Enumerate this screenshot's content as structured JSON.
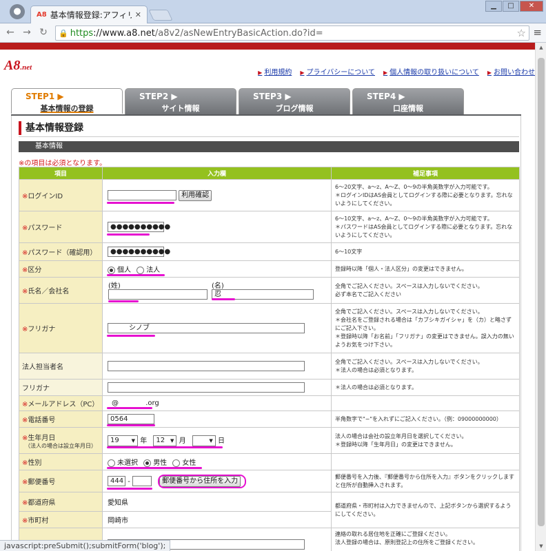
{
  "browser": {
    "tab_title": "基本情報登録:アフィリ",
    "tab_favicon": "A8",
    "url_https": "https",
    "url_host": "://www.a8.net",
    "url_path": "/a8v2/asNewEntryBasicAction.do?id=",
    "status_text": "javascript:preSubmit();submitForm('blog');"
  },
  "header": {
    "logo_main": "A8",
    "logo_sub": ".net",
    "links": [
      "利用規約",
      "プライバシーについて",
      "個人情報の取り扱いについて",
      "お問い合わせ"
    ]
  },
  "steps": [
    {
      "num": "STEP1 ▶",
      "name": "基本情報の登録"
    },
    {
      "num": "STEP2 ▶",
      "name": "サイト情報"
    },
    {
      "num": "STEP3 ▶",
      "name": "ブログ情報"
    },
    {
      "num": "STEP4 ▶",
      "name": "口座情報"
    }
  ],
  "page": {
    "title": "基本情報登録",
    "section": "基本情報",
    "required_note": "※の項目は必須となります。"
  },
  "table": {
    "headers": [
      "項目",
      "入力欄",
      "補足事項"
    ],
    "rows": {
      "login": {
        "label": "ログインID",
        "value": "",
        "button": "利用確認",
        "note": "6〜20文字、a〜z、A〜Z、0〜9の半角英数字が入力可能です。\n＊ログインIDはAS会員としてログインする際に必要となります。忘れないようにしてください。"
      },
      "password": {
        "label": "パスワード",
        "value": "●●●●●●●●●●",
        "note": "6〜10文字、a〜z、A〜Z、0〜9の半角英数字が入力可能です。\n＊パスワードはAS会員としてログインする際に必要となります。忘れないようにしてください。"
      },
      "password_confirm": {
        "label": "パスワード（確認用）",
        "value": "●●●●●●●●●●",
        "note": "6〜10文字"
      },
      "type": {
        "label": "区分",
        "opt1": "個人",
        "opt2": "法人",
        "note": "登録時以降「個人・法人区分」の変更はできません。"
      },
      "name": {
        "label": "氏名／会社名",
        "sei_label": "(姓)",
        "mei_label": "(名)",
        "sei_value": "",
        "mei_value": "忍",
        "note": "全角でご記入ください。スペースは入力しないでください。\n必ず本名でご記入ください"
      },
      "furigana": {
        "label": "フリガナ",
        "value": "シノブ",
        "note": "全角でご記入ください。スペースは入力しないでください。\n＊会社名をご登録される場合は「カブシキガイシャ」を（カ）と略さずにご記入下さい。\n＊登録時以降「お名前」「フリガナ」の変更はできません。誤入力の無いようお気をつけ下さい。"
      },
      "corp_contact": {
        "label": "法人担当者名",
        "value": "",
        "note": "全角でご記入ください。スペースは入力しないでください。\n＊法人の場合は必須となります。"
      },
      "corp_furigana": {
        "label": "フリガナ",
        "value": "",
        "note": "＊法人の場合は必須となります。"
      },
      "email": {
        "label": "メールアドレス（PC）",
        "at": "@",
        "domain": ".org"
      },
      "phone": {
        "label": "電話番号",
        "value": "0564",
        "note": "半角数字で\"−\"を入れずにご記入ください。（例：09000000000）"
      },
      "birth": {
        "label": "生年月日",
        "sublabel": "（法人の場合は設立年月日）",
        "year": "19",
        "year_unit": "年",
        "month": "12",
        "month_unit": "月",
        "day": "",
        "day_unit": "日",
        "note": "法人の場合は会社の設立年月日を選択してください。\n＊登録時以降「生年月日」の変更はできません。"
      },
      "gender": {
        "label": "性別",
        "opt1": "未選択",
        "opt2": "男性",
        "opt3": "女性"
      },
      "zip": {
        "label": "郵便番号",
        "value1": "444",
        "dash": "-",
        "value2": "",
        "button": "郵便番号から住所を入力",
        "note": "郵便番号を入力後、『郵便番号から住所を入力』ボタンをクリックしますと住所が自動挿入されます。"
      },
      "pref": {
        "label": "都道府県",
        "value": "愛知県",
        "note": "都道府県・市町村は入力できませんので、上記ボタンから選択するようにしてください。"
      },
      "city": {
        "label": "市町村",
        "value": "岡崎市"
      },
      "address": {
        "note": "連絡の取れる居住地を正確にご登録ください。\n法人登録の場合は、原則登記上の住所をご登録ください。"
      }
    }
  },
  "required_mark": "※"
}
